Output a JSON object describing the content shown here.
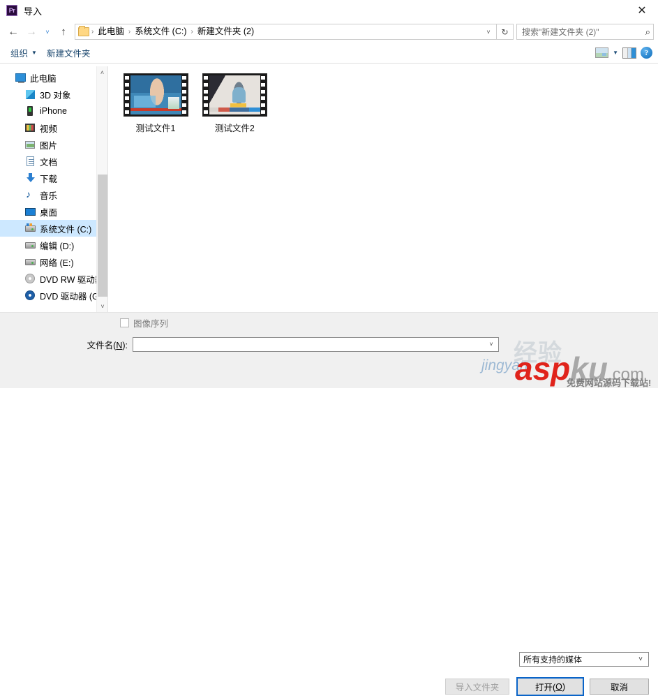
{
  "window": {
    "app_icon": "premiere-pr-icon",
    "app_icon_text": "Pr",
    "title": "导入",
    "close_label": "✕"
  },
  "nav": {
    "back_icon": "←",
    "forward_icon": "→",
    "recent_icon": "˅",
    "up_icon": "↑",
    "address_caret": "˅",
    "refresh_icon": "↻",
    "breadcrumb": [
      "此电脑",
      "系统文件 (C:)",
      "新建文件夹 (2)"
    ],
    "separator": "›"
  },
  "search": {
    "placeholder": "搜索\"新建文件夹 (2)\"",
    "icon": "⌕"
  },
  "toolbar": {
    "organize_label": "组织",
    "organize_caret": "▼",
    "new_folder_label": "新建文件夹",
    "view_caret": "▼",
    "help_label": "?"
  },
  "sidebar": {
    "items": [
      {
        "label": "此电脑",
        "icon": "pc-icon",
        "level": 0,
        "selected": false
      },
      {
        "label": "3D 对象",
        "icon": "3d-objects-icon",
        "level": 1,
        "selected": false
      },
      {
        "label": "iPhone",
        "icon": "iphone-icon",
        "level": 1,
        "selected": false
      },
      {
        "label": "视频",
        "icon": "videos-icon",
        "level": 1,
        "selected": false
      },
      {
        "label": "图片",
        "icon": "pictures-icon",
        "level": 1,
        "selected": false
      },
      {
        "label": "文档",
        "icon": "documents-icon",
        "level": 1,
        "selected": false
      },
      {
        "label": "下载",
        "icon": "downloads-icon",
        "level": 1,
        "selected": false
      },
      {
        "label": "音乐",
        "icon": "music-icon",
        "level": 1,
        "selected": false
      },
      {
        "label": "桌面",
        "icon": "desktop-icon",
        "level": 1,
        "selected": false
      },
      {
        "label": "系统文件 (C:)",
        "icon": "system-drive-icon",
        "level": 1,
        "selected": true
      },
      {
        "label": "编辑 (D:)",
        "icon": "drive-icon",
        "level": 1,
        "selected": false
      },
      {
        "label": "网络 (E:)",
        "icon": "drive-icon",
        "level": 1,
        "selected": false
      },
      {
        "label": "DVD RW 驱动器",
        "icon": "dvd-rw-icon",
        "level": 1,
        "selected": false
      },
      {
        "label": "DVD 驱动器 (G:",
        "icon": "dvd-icon",
        "level": 1,
        "selected": false
      }
    ],
    "scroll_up_icon": "˄",
    "scroll_down_icon": "˅"
  },
  "files": [
    {
      "name": "测试文件1",
      "type": "video"
    },
    {
      "name": "测试文件2",
      "type": "video"
    }
  ],
  "options": {
    "image_sequence_label": "图像序列",
    "image_sequence_checked": false,
    "image_sequence_enabled": false
  },
  "filename": {
    "label": "文件名(N):",
    "label_plain": "文件名(",
    "label_mnemonic": "N",
    "label_tail": "):",
    "value": "",
    "caret": "˅"
  },
  "filetype": {
    "value": "所有支持的媒体",
    "caret": "˅"
  },
  "buttons": {
    "import_folder": "导入文件夹",
    "import_folder_enabled": false,
    "open": "打开(O)",
    "open_plain": "打开(",
    "open_mnemonic": "O",
    "open_tail": ")",
    "cancel": "取消"
  },
  "watermark": {
    "top": "经验",
    "brand_red": "asp",
    "brand_gray": "ku",
    "brand_suffix": ".com",
    "sub": "免费网站源码下载站!",
    "site_small": "jingyan"
  },
  "colors": {
    "selection": "#cde8ff",
    "link": "#16436b",
    "accent_blue": "#0a64c8",
    "watermark_red": "#e0231b"
  }
}
